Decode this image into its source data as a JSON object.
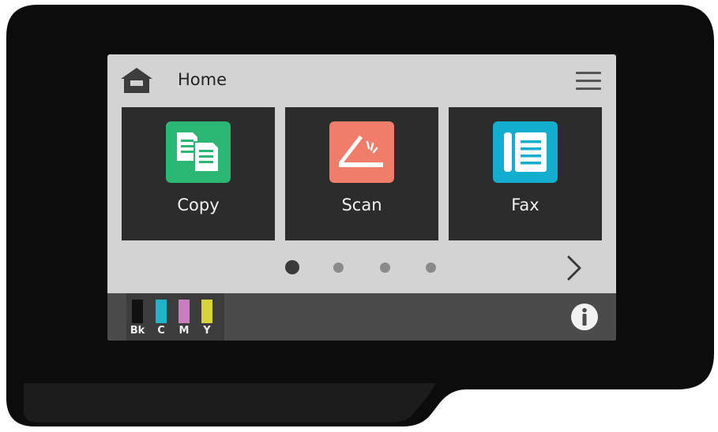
{
  "header": {
    "title": "Home"
  },
  "tiles": [
    {
      "label": "Copy",
      "icon": "copy-icon",
      "color": "#2bb673"
    },
    {
      "label": "Scan",
      "icon": "scan-icon",
      "color": "#f07d6a"
    },
    {
      "label": "Fax",
      "icon": "fax-icon",
      "color": "#13aecf"
    }
  ],
  "pagination": {
    "current_page": 1,
    "total_pages": 4
  },
  "ink_levels": [
    {
      "label": "Bk",
      "color": "#111111"
    },
    {
      "label": "C",
      "color": "#1fb5c8"
    },
    {
      "label": "M",
      "color": "#c77fc0"
    },
    {
      "label": "Y",
      "color": "#d6d43a"
    }
  ],
  "colors": {
    "screen_background": "#d3d3d3",
    "tile_background": "#2c2c2c",
    "footer_background": "#4b4b4b",
    "bezel": "#0c0c0c"
  }
}
